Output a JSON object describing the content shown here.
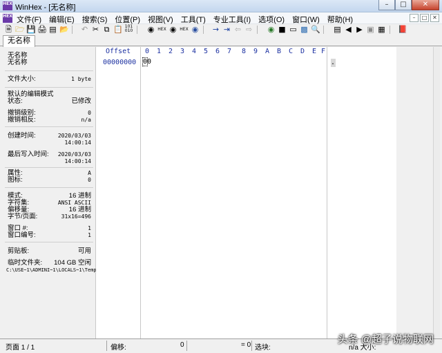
{
  "window": {
    "title": "WinHex - [无名称]",
    "app_icon_text": "HEX"
  },
  "menu": [
    "文件(F)",
    "编辑(E)",
    "搜索(S)",
    "位置(P)",
    "视图(V)",
    "工具(T)",
    "专业工具(I)",
    "选项(O)",
    "窗口(W)",
    "帮助(H)"
  ],
  "tab": {
    "label": "无名称"
  },
  "info": {
    "name1": "无名称",
    "name2": "无名称",
    "file_size_label": "文件大小:",
    "file_size_value": "1 byte",
    "edit_mode_label": "默认的编辑模式",
    "state_label": "状态:",
    "state_value": "已修改",
    "undo_level_label": "撤销级别:",
    "undo_level_value": "0",
    "undo_reverse_label": "撤销相反:",
    "undo_reverse_value": "n/a",
    "created_label": "创建时间:",
    "created_date": "2020/03/03",
    "created_time": "14:00:14",
    "lastwrite_label": "最后写入时间:",
    "lastwrite_date": "2020/03/03",
    "lastwrite_time": "14:00:14",
    "attr_label": "属性:",
    "attr_value": "A",
    "icon_label": "图标:",
    "icon_value": "0",
    "mode_label": "模式:",
    "mode_value": "16 进制",
    "charset_label": "字符集:",
    "charset_value": "ANSI ASCII",
    "offset_label": "偏移量:",
    "offset_value": "16 进制",
    "bpp_label": "字节/页面:",
    "bpp_value": "31x16=496",
    "window_no_label": "窗口 #:",
    "window_no_value": "1",
    "window_id_label": "窗口编号:",
    "window_id_value": "1",
    "clipboard_label": "剪贴板:",
    "clipboard_value": "可用",
    "temp_label": "临时文件夹:",
    "temp_value": "104 GB 空闲",
    "temp_path": "C:\\USE~1\\ADMINI~1\\LOCALS~1\\Temp"
  },
  "hex": {
    "offset_header": "Offset",
    "columns": [
      "0",
      "1",
      "2",
      "3",
      "4",
      "5",
      "6",
      "7",
      "8",
      "9",
      "A",
      "B",
      "C",
      "D",
      "E",
      "F"
    ],
    "row_offset": "00000000",
    "row_byte_first": "0",
    "row_byte_rest": "0",
    "text_char": "."
  },
  "status": {
    "page": "页面 1 / 1",
    "offset_label": "偏移:",
    "offset_value": "0",
    "eq_value": "= 0",
    "select_label": "选块:",
    "size_label": "n/a   大小:"
  },
  "watermark": "头条 @超子说物联网"
}
